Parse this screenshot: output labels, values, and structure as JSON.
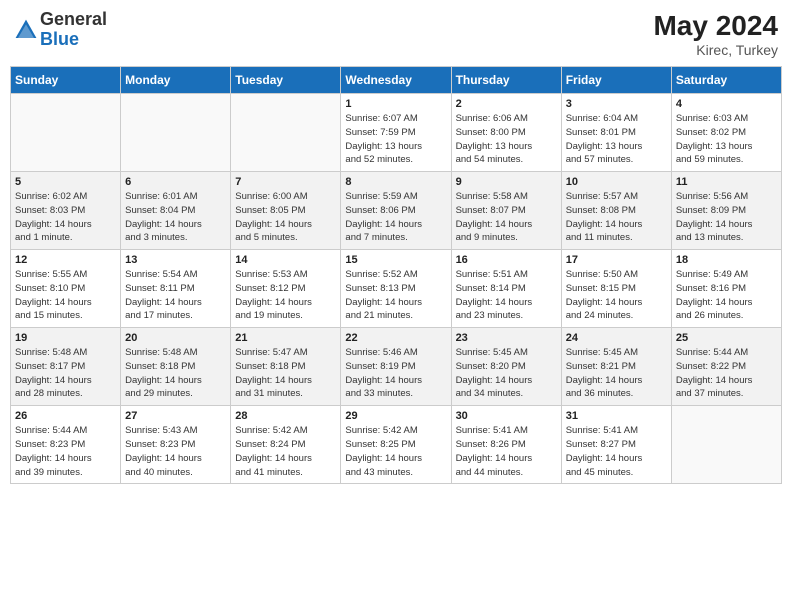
{
  "header": {
    "logo_general": "General",
    "logo_blue": "Blue",
    "month_year": "May 2024",
    "location": "Kirec, Turkey"
  },
  "weekdays": [
    "Sunday",
    "Monday",
    "Tuesday",
    "Wednesday",
    "Thursday",
    "Friday",
    "Saturday"
  ],
  "weeks": [
    [
      {
        "day": "",
        "info": []
      },
      {
        "day": "",
        "info": []
      },
      {
        "day": "",
        "info": []
      },
      {
        "day": "1",
        "info": [
          "Sunrise: 6:07 AM",
          "Sunset: 7:59 PM",
          "Daylight: 13 hours",
          "and 52 minutes."
        ]
      },
      {
        "day": "2",
        "info": [
          "Sunrise: 6:06 AM",
          "Sunset: 8:00 PM",
          "Daylight: 13 hours",
          "and 54 minutes."
        ]
      },
      {
        "day": "3",
        "info": [
          "Sunrise: 6:04 AM",
          "Sunset: 8:01 PM",
          "Daylight: 13 hours",
          "and 57 minutes."
        ]
      },
      {
        "day": "4",
        "info": [
          "Sunrise: 6:03 AM",
          "Sunset: 8:02 PM",
          "Daylight: 13 hours",
          "and 59 minutes."
        ]
      }
    ],
    [
      {
        "day": "5",
        "info": [
          "Sunrise: 6:02 AM",
          "Sunset: 8:03 PM",
          "Daylight: 14 hours",
          "and 1 minute."
        ]
      },
      {
        "day": "6",
        "info": [
          "Sunrise: 6:01 AM",
          "Sunset: 8:04 PM",
          "Daylight: 14 hours",
          "and 3 minutes."
        ]
      },
      {
        "day": "7",
        "info": [
          "Sunrise: 6:00 AM",
          "Sunset: 8:05 PM",
          "Daylight: 14 hours",
          "and 5 minutes."
        ]
      },
      {
        "day": "8",
        "info": [
          "Sunrise: 5:59 AM",
          "Sunset: 8:06 PM",
          "Daylight: 14 hours",
          "and 7 minutes."
        ]
      },
      {
        "day": "9",
        "info": [
          "Sunrise: 5:58 AM",
          "Sunset: 8:07 PM",
          "Daylight: 14 hours",
          "and 9 minutes."
        ]
      },
      {
        "day": "10",
        "info": [
          "Sunrise: 5:57 AM",
          "Sunset: 8:08 PM",
          "Daylight: 14 hours",
          "and 11 minutes."
        ]
      },
      {
        "day": "11",
        "info": [
          "Sunrise: 5:56 AM",
          "Sunset: 8:09 PM",
          "Daylight: 14 hours",
          "and 13 minutes."
        ]
      }
    ],
    [
      {
        "day": "12",
        "info": [
          "Sunrise: 5:55 AM",
          "Sunset: 8:10 PM",
          "Daylight: 14 hours",
          "and 15 minutes."
        ]
      },
      {
        "day": "13",
        "info": [
          "Sunrise: 5:54 AM",
          "Sunset: 8:11 PM",
          "Daylight: 14 hours",
          "and 17 minutes."
        ]
      },
      {
        "day": "14",
        "info": [
          "Sunrise: 5:53 AM",
          "Sunset: 8:12 PM",
          "Daylight: 14 hours",
          "and 19 minutes."
        ]
      },
      {
        "day": "15",
        "info": [
          "Sunrise: 5:52 AM",
          "Sunset: 8:13 PM",
          "Daylight: 14 hours",
          "and 21 minutes."
        ]
      },
      {
        "day": "16",
        "info": [
          "Sunrise: 5:51 AM",
          "Sunset: 8:14 PM",
          "Daylight: 14 hours",
          "and 23 minutes."
        ]
      },
      {
        "day": "17",
        "info": [
          "Sunrise: 5:50 AM",
          "Sunset: 8:15 PM",
          "Daylight: 14 hours",
          "and 24 minutes."
        ]
      },
      {
        "day": "18",
        "info": [
          "Sunrise: 5:49 AM",
          "Sunset: 8:16 PM",
          "Daylight: 14 hours",
          "and 26 minutes."
        ]
      }
    ],
    [
      {
        "day": "19",
        "info": [
          "Sunrise: 5:48 AM",
          "Sunset: 8:17 PM",
          "Daylight: 14 hours",
          "and 28 minutes."
        ]
      },
      {
        "day": "20",
        "info": [
          "Sunrise: 5:48 AM",
          "Sunset: 8:18 PM",
          "Daylight: 14 hours",
          "and 29 minutes."
        ]
      },
      {
        "day": "21",
        "info": [
          "Sunrise: 5:47 AM",
          "Sunset: 8:18 PM",
          "Daylight: 14 hours",
          "and 31 minutes."
        ]
      },
      {
        "day": "22",
        "info": [
          "Sunrise: 5:46 AM",
          "Sunset: 8:19 PM",
          "Daylight: 14 hours",
          "and 33 minutes."
        ]
      },
      {
        "day": "23",
        "info": [
          "Sunrise: 5:45 AM",
          "Sunset: 8:20 PM",
          "Daylight: 14 hours",
          "and 34 minutes."
        ]
      },
      {
        "day": "24",
        "info": [
          "Sunrise: 5:45 AM",
          "Sunset: 8:21 PM",
          "Daylight: 14 hours",
          "and 36 minutes."
        ]
      },
      {
        "day": "25",
        "info": [
          "Sunrise: 5:44 AM",
          "Sunset: 8:22 PM",
          "Daylight: 14 hours",
          "and 37 minutes."
        ]
      }
    ],
    [
      {
        "day": "26",
        "info": [
          "Sunrise: 5:44 AM",
          "Sunset: 8:23 PM",
          "Daylight: 14 hours",
          "and 39 minutes."
        ]
      },
      {
        "day": "27",
        "info": [
          "Sunrise: 5:43 AM",
          "Sunset: 8:23 PM",
          "Daylight: 14 hours",
          "and 40 minutes."
        ]
      },
      {
        "day": "28",
        "info": [
          "Sunrise: 5:42 AM",
          "Sunset: 8:24 PM",
          "Daylight: 14 hours",
          "and 41 minutes."
        ]
      },
      {
        "day": "29",
        "info": [
          "Sunrise: 5:42 AM",
          "Sunset: 8:25 PM",
          "Daylight: 14 hours",
          "and 43 minutes."
        ]
      },
      {
        "day": "30",
        "info": [
          "Sunrise: 5:41 AM",
          "Sunset: 8:26 PM",
          "Daylight: 14 hours",
          "and 44 minutes."
        ]
      },
      {
        "day": "31",
        "info": [
          "Sunrise: 5:41 AM",
          "Sunset: 8:27 PM",
          "Daylight: 14 hours",
          "and 45 minutes."
        ]
      },
      {
        "day": "",
        "info": []
      }
    ]
  ]
}
